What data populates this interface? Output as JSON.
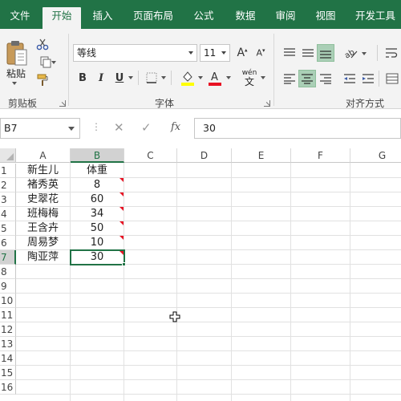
{
  "tabs": [
    {
      "label": "文件",
      "active": false
    },
    {
      "label": "开始",
      "active": true
    },
    {
      "label": "插入",
      "active": false
    },
    {
      "label": "页面布局",
      "active": false
    },
    {
      "label": "公式",
      "active": false
    },
    {
      "label": "数据",
      "active": false
    },
    {
      "label": "审阅",
      "active": false
    },
    {
      "label": "视图",
      "active": false
    },
    {
      "label": "开发工具",
      "active": false
    }
  ],
  "ribbon": {
    "clipboard": {
      "paste_label": "粘贴",
      "group_label": "剪贴板"
    },
    "font": {
      "font_name": "等线",
      "font_size": "11",
      "bold": "B",
      "italic": "I",
      "underline": "U",
      "phonetic": "wén",
      "group_label": "字体",
      "font_color": "#e81123",
      "fill_color": "#ffff00"
    },
    "alignment": {
      "group_label": "对齐方式"
    }
  },
  "formula_bar": {
    "name_box": "B7",
    "dots": "⋮",
    "cancel": "✕",
    "enter": "✓",
    "fx": "fx",
    "value": "30"
  },
  "grid": {
    "columns": [
      "A",
      "B",
      "C",
      "D",
      "E",
      "F",
      "G"
    ],
    "rows": [
      "1",
      "2",
      "3",
      "4",
      "5",
      "6",
      "7",
      "8",
      "9",
      "10",
      "11",
      "12",
      "13",
      "14",
      "15",
      "16"
    ],
    "selected_cell": "B7",
    "cells": [
      {
        "row": 1,
        "a": "新生儿",
        "b": "体重"
      },
      {
        "row": 2,
        "a": "褚秀英",
        "b": "8"
      },
      {
        "row": 3,
        "a": "史翠花",
        "b": "60"
      },
      {
        "row": 4,
        "a": "班梅梅",
        "b": "34"
      },
      {
        "row": 5,
        "a": "王含卉",
        "b": "50"
      },
      {
        "row": 6,
        "a": "周易梦",
        "b": "10"
      },
      {
        "row": 7,
        "a": "陶亚萍",
        "b": "30"
      }
    ]
  },
  "colors": {
    "accent": "#217346",
    "error_marker": "#e81123"
  }
}
